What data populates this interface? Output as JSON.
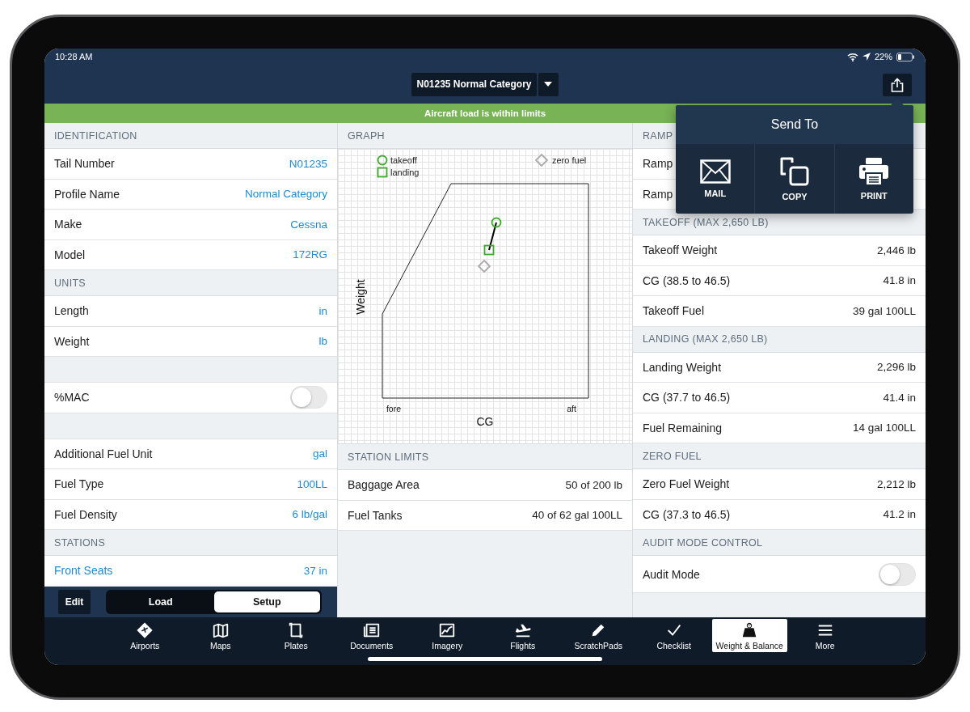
{
  "status_bar": {
    "time": "10:28 AM",
    "battery": "22%"
  },
  "nav_bar": {
    "profile_selector": "N01235 Normal Category"
  },
  "banner": {
    "text": "Aircraft load is within limits"
  },
  "left_panel": {
    "sections": [
      {
        "header": "IDENTIFICATION",
        "rows": [
          {
            "kind": "value",
            "label": "Tail Number",
            "value": "N01235"
          },
          {
            "kind": "value",
            "label": "Profile Name",
            "value": "Normal Category"
          },
          {
            "kind": "value",
            "label": "Make",
            "value": "Cessna"
          },
          {
            "kind": "value",
            "label": "Model",
            "value": "172RG"
          }
        ]
      },
      {
        "header": "UNITS",
        "rows": [
          {
            "kind": "value",
            "label": "Length",
            "value": "in"
          },
          {
            "kind": "value",
            "label": "Weight",
            "value": "lb"
          }
        ]
      },
      {
        "rows": [
          {
            "kind": "spacer"
          },
          {
            "kind": "toggle",
            "label": "%MAC",
            "on": false
          },
          {
            "kind": "spacer"
          },
          {
            "kind": "value",
            "label": "Additional Fuel Unit",
            "value": "gal"
          },
          {
            "kind": "value",
            "label": "Fuel Type",
            "value": "100LL"
          },
          {
            "kind": "value",
            "label": "Fuel Density",
            "value": "6 lb/gal"
          }
        ]
      },
      {
        "header": "STATIONS",
        "rows": [
          {
            "kind": "station",
            "label": "Front Seats",
            "value": "37 in"
          }
        ]
      }
    ],
    "footer": {
      "edit_button": "Edit",
      "segments": [
        {
          "label": "Load",
          "selected": false
        },
        {
          "label": "Setup",
          "selected": true
        }
      ]
    }
  },
  "graph_panel": {
    "header": "GRAPH",
    "graph": {
      "legend": [
        {
          "kind": "circle",
          "label": "takeoff",
          "color": "#3aab28"
        },
        {
          "kind": "square",
          "label": "landing",
          "color": "#3aab28"
        },
        {
          "kind": "diamond",
          "label": "zero fuel",
          "color": "#aaaaaa"
        }
      ],
      "ylabel": "Weight",
      "xlabel": "CG",
      "x_start_label": "fore",
      "x_end_label": "aft"
    },
    "station_limits": {
      "header": "STATION LIMITS",
      "rows": [
        {
          "kind": "reading",
          "label": "Baggage Area",
          "value": "50 of 200 lb"
        },
        {
          "kind": "reading",
          "label": "Fuel Tanks",
          "value": "40 of 62 gal 100LL"
        }
      ]
    }
  },
  "right_panel": {
    "sections": [
      {
        "header": "RAMP",
        "rows": [
          {
            "kind": "reading",
            "label": "Ramp"
          },
          {
            "kind": "reading",
            "label": "Ramp"
          }
        ]
      },
      {
        "header": "TAKEOFF (MAX 2,650 LB)",
        "rows": [
          {
            "kind": "reading",
            "label": "Takeoff Weight",
            "value": "2,446 lb"
          },
          {
            "kind": "reading",
            "label": "CG (38.5 to 46.5)",
            "value": "41.8 in"
          },
          {
            "kind": "reading",
            "label": "Takeoff Fuel",
            "value": "39 gal 100LL"
          }
        ]
      },
      {
        "header": "LANDING (MAX 2,650 LB)",
        "rows": [
          {
            "kind": "reading",
            "label": "Landing Weight",
            "value": "2,296 lb"
          },
          {
            "kind": "reading",
            "label": "CG (37.7 to 46.5)",
            "value": "41.4 in"
          },
          {
            "kind": "reading",
            "label": "Fuel Remaining",
            "value": "14 gal 100LL"
          }
        ]
      },
      {
        "header": "ZERO FUEL",
        "rows": [
          {
            "kind": "reading",
            "label": "Zero Fuel Weight",
            "value": "2,212 lb"
          },
          {
            "kind": "reading",
            "label": "CG (37.3 to 46.5)",
            "value": "41.2 in"
          }
        ]
      },
      {
        "header": "AUDIT MODE CONTROL",
        "rows": [
          {
            "kind": "toggle",
            "label": "Audit Mode",
            "on": false
          }
        ]
      }
    ]
  },
  "send_to_popup": {
    "title": "Send To",
    "actions": [
      {
        "kind": "mail",
        "label": "MAIL"
      },
      {
        "kind": "copy",
        "label": "COPY"
      },
      {
        "kind": "print",
        "label": "PRINT"
      }
    ]
  },
  "tab_bar": [
    {
      "kind": "airports",
      "label": "Airports",
      "selected": false
    },
    {
      "kind": "maps",
      "label": "Maps",
      "selected": false
    },
    {
      "kind": "plates",
      "label": "Plates",
      "selected": false
    },
    {
      "kind": "documents",
      "label": "Documents",
      "selected": false
    },
    {
      "kind": "imagery",
      "label": "Imagery",
      "selected": false
    },
    {
      "kind": "flights",
      "label": "Flights",
      "selected": false
    },
    {
      "kind": "scratchpads",
      "label": "ScratchPads",
      "selected": false
    },
    {
      "kind": "checklist",
      "label": "Checklist",
      "selected": false
    },
    {
      "kind": "weight",
      "label": "Weight & Balance",
      "selected": true
    },
    {
      "kind": "more",
      "label": "More",
      "selected": false
    }
  ]
}
